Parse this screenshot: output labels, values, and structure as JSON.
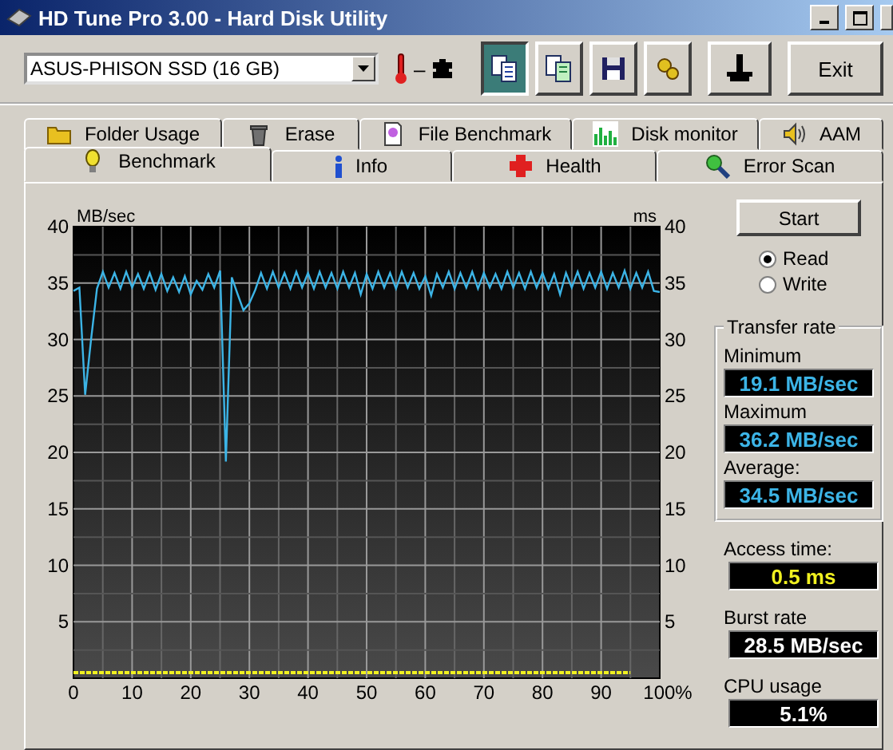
{
  "window": {
    "title": "HD Tune Pro 3.00 - Hard Disk Utility"
  },
  "toolbar": {
    "drive": "ASUS-PHISON SSD (16 GB)",
    "temperature": "–",
    "tool_buttons": [
      {
        "kind": "copy",
        "selected": true
      },
      {
        "kind": "copy-all",
        "selected": false
      },
      {
        "kind": "save",
        "selected": false
      },
      {
        "kind": "options",
        "selected": false
      },
      {
        "kind": "exit-down",
        "selected": false
      }
    ],
    "exit_button": "Exit"
  },
  "tabs": {
    "top_row": [
      {
        "label": "Folder Usage",
        "kind": "folder",
        "selected": false
      },
      {
        "label": "Erase",
        "kind": "trash",
        "selected": false
      },
      {
        "label": "File Benchmark",
        "kind": "file",
        "selected": false
      },
      {
        "label": "Disk monitor",
        "kind": "bars",
        "selected": false
      },
      {
        "label": "AAM",
        "kind": "speaker",
        "selected": false
      }
    ],
    "bottom_row": [
      {
        "label": "Benchmark",
        "kind": "bulb",
        "selected": true
      },
      {
        "label": "Info",
        "kind": "info",
        "selected": false
      },
      {
        "label": "Health",
        "kind": "cross",
        "selected": false
      },
      {
        "label": "Error Scan",
        "kind": "magnifier",
        "selected": false
      }
    ]
  },
  "chart": {
    "right_axis_label": "ms",
    "right_ticks": [
      "40",
      "35",
      "30",
      "25",
      "20",
      "15",
      "10",
      "5"
    ],
    "chart_data": {
      "type": "line",
      "ylabel": "MB/sec",
      "grid": true,
      "x": [
        0,
        1,
        2,
        3,
        4,
        5,
        6,
        7,
        8,
        9,
        10,
        11,
        12,
        13,
        14,
        15,
        16,
        17,
        18,
        19,
        20,
        21,
        22,
        23,
        24,
        25,
        26,
        27,
        28,
        29,
        30,
        31,
        32,
        33,
        34,
        35,
        36,
        37,
        38,
        39,
        40,
        41,
        42,
        43,
        44,
        45,
        46,
        47,
        48,
        49,
        50,
        51,
        52,
        53,
        54,
        55,
        56,
        57,
        58,
        59,
        60,
        61,
        62,
        63,
        64,
        65,
        66,
        67,
        68,
        69,
        70,
        71,
        72,
        73,
        74,
        75,
        76,
        77,
        78,
        79,
        80,
        81,
        82,
        83,
        84,
        85,
        86,
        87,
        88,
        89,
        90,
        91,
        92,
        93,
        94,
        95,
        96,
        97,
        98,
        99,
        100
      ],
      "series": [
        {
          "color": "#3cb4e6",
          "line_style": "solid",
          "values": [
            34.3,
            34.6,
            25.1,
            30,
            34.5,
            36,
            34.6,
            35.9,
            34.5,
            36,
            34.6,
            35.8,
            34.5,
            35.9,
            34.4,
            35.8,
            34.3,
            35.5,
            34.2,
            35.6,
            34.0,
            35.2,
            34.4,
            35.8,
            34.6,
            36.1,
            19.2,
            35.5,
            34.0,
            32.6,
            33.2,
            34.4,
            35.9,
            34.5,
            36,
            34.6,
            35.9,
            34.5,
            36,
            34.6,
            35.9,
            34.5,
            36,
            34.6,
            35.9,
            34.5,
            36,
            34.6,
            35.9,
            34.0,
            35.8,
            34.5,
            36,
            34.6,
            35.9,
            34.5,
            36,
            34.6,
            35.9,
            34.5,
            35.6,
            33.9,
            35.8,
            34.6,
            36,
            34.5,
            35.9,
            34.6,
            36,
            34.5,
            35.9,
            34.6,
            35.8,
            34.5,
            36,
            34.6,
            35.9,
            34.5,
            36,
            34.6,
            35.9,
            34.5,
            35.8,
            34.0,
            35.9,
            34.6,
            36,
            34.5,
            35.9,
            34.6,
            36,
            34.5,
            35.9,
            34.6,
            36.1,
            34.5,
            35.9,
            34.6,
            36,
            34.3,
            34.2
          ]
        },
        {
          "color": "#f0f020",
          "line_style": "dotted",
          "values": [
            0.5,
            0.5,
            0.5,
            0.5,
            0.5,
            0.5,
            0.5,
            0.5,
            0.5,
            0.5,
            0.5,
            0.5,
            0.5,
            0.5,
            0.5,
            0.5,
            0.5,
            0.5,
            0.5,
            0.5,
            0.5,
            0.5,
            0.5,
            0.5,
            0.5,
            0.5,
            0.5,
            0.5,
            0.5,
            0.5,
            0.5,
            0.5,
            0.5,
            0.5,
            0.5,
            0.5,
            0.5,
            0.5,
            0.5,
            0.5,
            0.5,
            0.5,
            0.5,
            0.5,
            0.5,
            0.5,
            0.5,
            0.5,
            0.5,
            0.5,
            0.5,
            0.5,
            0.5,
            0.5,
            0.5,
            0.5,
            0.5,
            0.5,
            0.5,
            0.5,
            0.5,
            0.5,
            0.5,
            0.5,
            0.5,
            0.5,
            0.5,
            0.5,
            0.5,
            0.5,
            0.5,
            0.5,
            0.5,
            0.5,
            0.5,
            0.5,
            0.5,
            0.5,
            0.5,
            0.5,
            0.5,
            0.5,
            0.5,
            0.5,
            0.5,
            0.5,
            0.5,
            0.5,
            0.5,
            0.5,
            0.5,
            0.5,
            0.5,
            0.5,
            0.5,
            0.5,
            null,
            null,
            null,
            null,
            null
          ]
        }
      ],
      "xlim": [
        0,
        100
      ],
      "ylim": [
        0,
        40
      ],
      "xticks": [
        0,
        10,
        20,
        30,
        40,
        50,
        60,
        70,
        80,
        90,
        {
          "value": 100,
          "label": "100%"
        }
      ],
      "yticks": [
        5,
        10,
        15,
        20,
        25,
        30,
        35,
        40
      ]
    }
  },
  "panel": {
    "start_button": "Start",
    "modes": [
      {
        "label": "Read",
        "selected": true
      },
      {
        "label": "Write",
        "selected": false
      }
    ],
    "group_title": "Transfer rate",
    "transfer": [
      {
        "label": "Minimum",
        "value": "19.1 MB/sec"
      },
      {
        "label": "Maximum",
        "value": "36.2 MB/sec"
      },
      {
        "label": "Average:",
        "value": "34.5 MB/sec"
      }
    ],
    "readouts": [
      {
        "label": "Access time:",
        "value": "0.5 ms",
        "kind": "time"
      },
      {
        "label": "Burst rate",
        "value": "28.5 MB/sec",
        "kind": "rate"
      },
      {
        "label": "CPU usage",
        "value": "5.1%",
        "kind": "usage"
      }
    ]
  }
}
